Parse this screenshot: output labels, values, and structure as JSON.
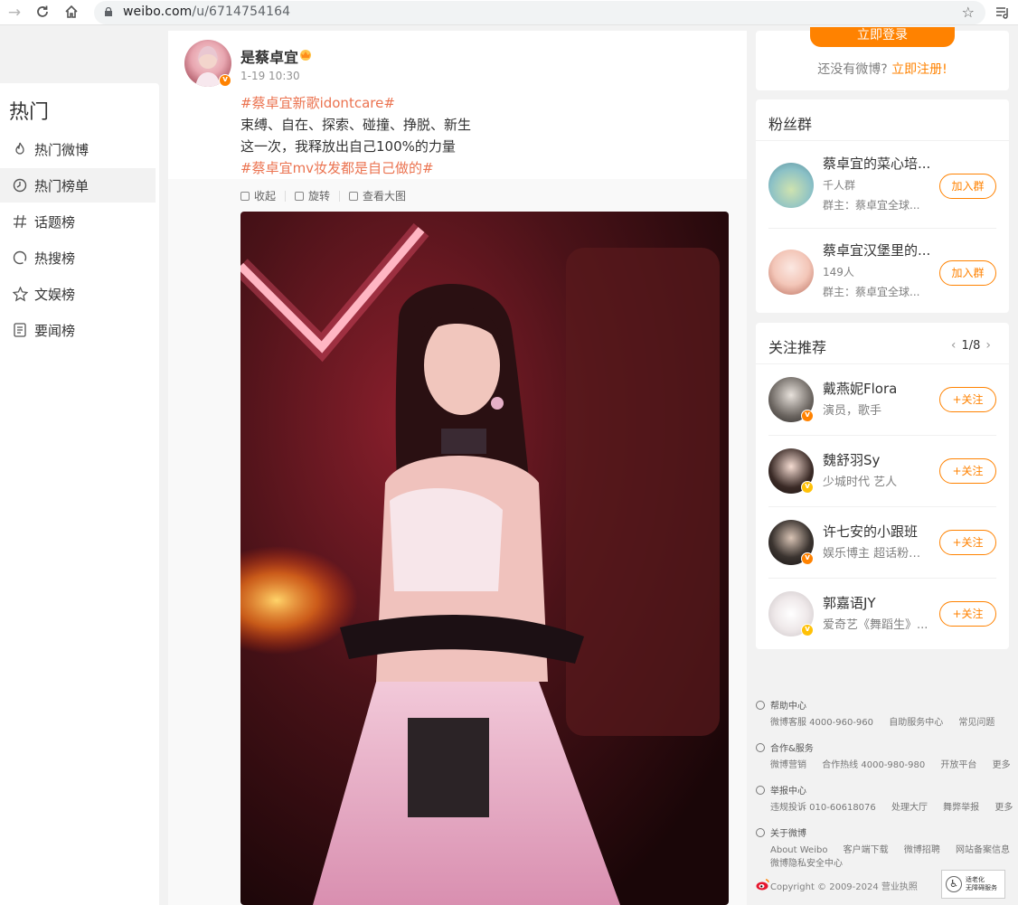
{
  "browser": {
    "url_host": "weibo.com",
    "url_path": "/u/6714754164"
  },
  "leftnav": {
    "title": "热门",
    "items": [
      {
        "label": "热门微博",
        "icon": "flame-icon"
      },
      {
        "label": "热门榜单",
        "icon": "clock-icon"
      },
      {
        "label": "话题榜",
        "icon": "hashtag-icon"
      },
      {
        "label": "热搜榜",
        "icon": "search-trend-icon"
      },
      {
        "label": "文娱榜",
        "icon": "star-icon"
      },
      {
        "label": "要闻榜",
        "icon": "news-icon"
      }
    ]
  },
  "post": {
    "author": "是蔡卓宜",
    "time": "1-19 10:30",
    "hashtag1": "#蔡卓宜新歌idontcare#",
    "line1": "束缚、自在、探索、碰撞、挣脱、新生",
    "line2": "这一次，我释放出自己100%的力量",
    "hashtag2": "#蔡卓宜mv妆发都是自己做的#",
    "toolbar": {
      "collapse": "收起",
      "rotate": "旋转",
      "view_large": "查看大图"
    }
  },
  "login": {
    "button": "立即登录",
    "prompt": "还没有微博?",
    "register": "立即注册!"
  },
  "fan_groups": {
    "title": "粉丝群",
    "items": [
      {
        "name": "蔡卓宜的菜心培...",
        "size": "千人群",
        "owner": "群主：蔡卓宜全球...",
        "button": "加入群"
      },
      {
        "name": "蔡卓宜汉堡里的...",
        "size": "149人",
        "owner": "群主：蔡卓宜全球...",
        "button": "加入群"
      }
    ]
  },
  "recommend": {
    "title": "关注推荐",
    "page": "1/8",
    "items": [
      {
        "name": "戴燕妮Flora",
        "desc": "演员，歌手",
        "button": "+关注"
      },
      {
        "name": "魏舒羽Sy",
        "desc": "少城时代 艺人",
        "button": "+关注"
      },
      {
        "name": "许七安的小跟班",
        "desc": "娱乐博主 超话粉丝...",
        "button": "+关注"
      },
      {
        "name": "郭嘉语JY",
        "desc": "爱奇艺《舞蹈生》...",
        "button": "+关注"
      }
    ]
  },
  "footer": {
    "help": {
      "title": "帮助中心",
      "links": [
        "微博客服 4000-960-960",
        "自助服务中心",
        "常见问题"
      ]
    },
    "coop": {
      "title": "合作&服务",
      "links": [
        "微博营销",
        "合作热线 4000-980-980",
        "开放平台",
        "更多"
      ]
    },
    "report": {
      "title": "举报中心",
      "links": [
        "违规投诉 010-60618076",
        "处理大厅",
        "舞弊举报",
        "更多"
      ]
    },
    "about": {
      "title": "关于微博",
      "links": [
        "About Weibo",
        "客户端下载",
        "微博招聘",
        "网站备案信息"
      ],
      "links2": [
        "微博隐私安全中心"
      ]
    },
    "copyright": "Copyright © 2009-2024 营业执照",
    "access_line1": "适老化",
    "access_line2": "无障碍服务"
  }
}
